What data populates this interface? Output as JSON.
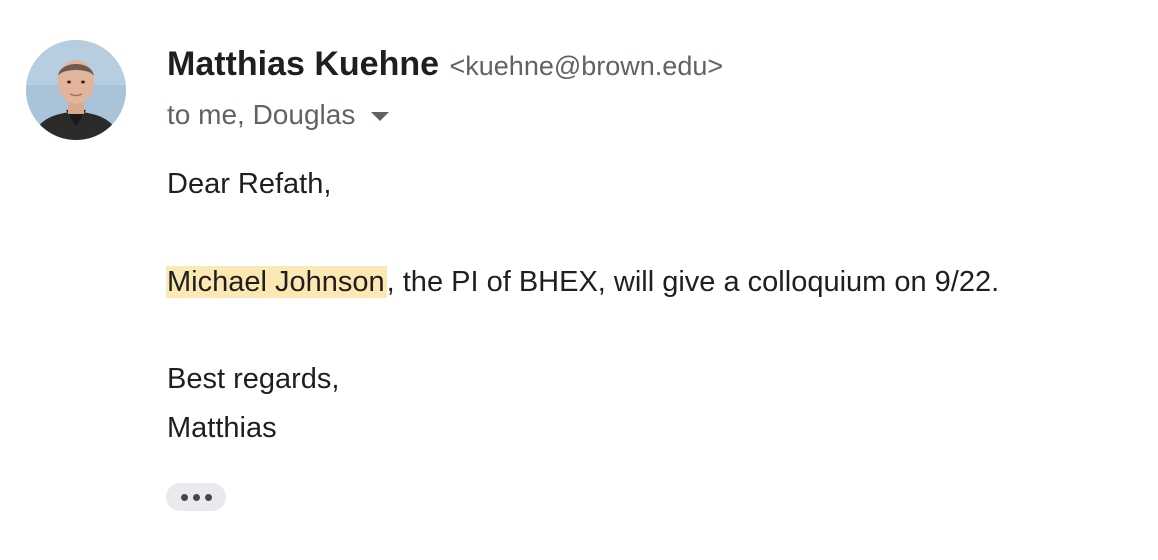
{
  "message": {
    "sender": {
      "name": "Matthias Kuehne",
      "email": "<kuehne@brown.edu>",
      "avatar": "sender-avatar-photo"
    },
    "recipients_text": "to me, Douglas",
    "body": {
      "greeting": "Dear Refath,",
      "highlighted_name": "Michael Johnson",
      "sentence_rest": ", the PI of BHEX, will give a colloquium on 9/22.",
      "closing": "Best regards,",
      "signature": "Matthias"
    },
    "highlight_color": "#fce8b2",
    "show_trimmed_content_icon": "ellipsis-icon"
  }
}
